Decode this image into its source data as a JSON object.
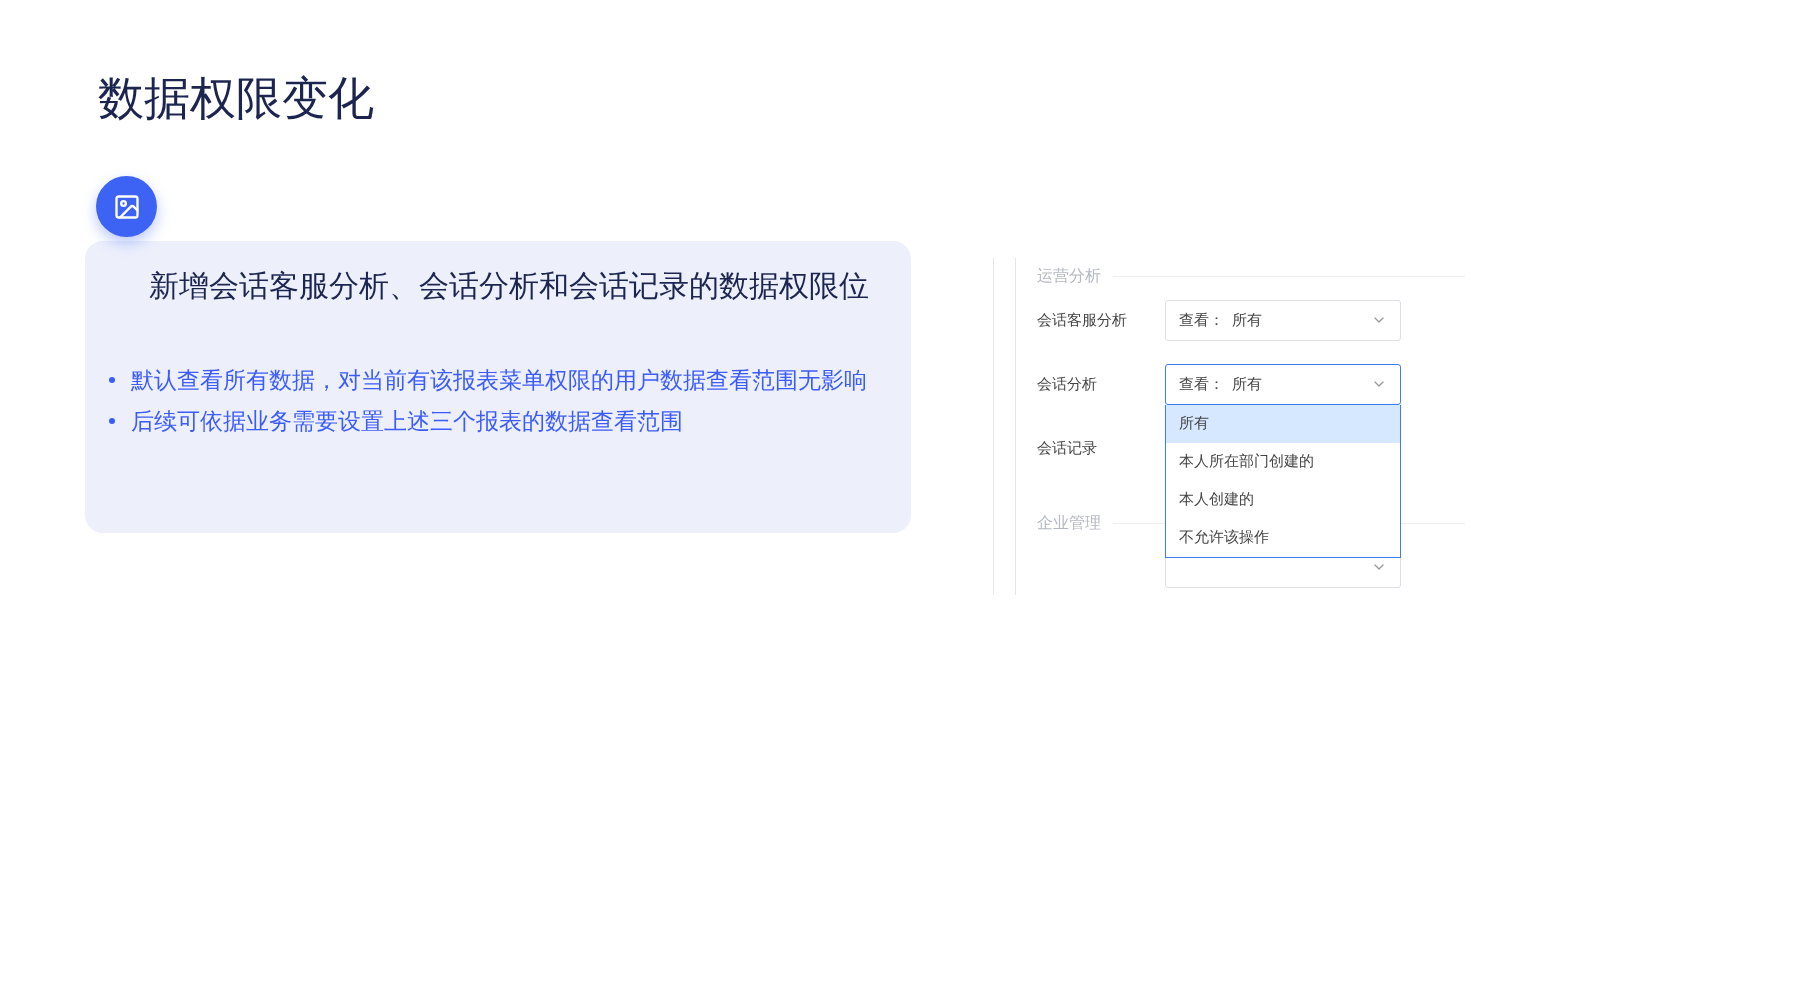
{
  "title": "数据权限变化",
  "card": {
    "heading": "新增会话客服分析、会话分析和会话记录的数据权限位",
    "bullets": [
      "默认查看所有数据，对当前有该报表菜单权限的用户数据查看范围无影响",
      "后续可依据业务需要设置上述三个报表的数据查看范围"
    ]
  },
  "settings": {
    "sections": [
      {
        "title": "运营分析",
        "rows": [
          {
            "label": "会话客服分析",
            "select": {
              "prefix": "查看：",
              "value": "所有",
              "expanded": false
            }
          },
          {
            "label": "会话分析",
            "select": {
              "prefix": "查看：",
              "value": "所有",
              "expanded": true,
              "options": [
                {
                  "label": "所有",
                  "selected": true
                },
                {
                  "label": "本人所在部门创建的",
                  "selected": false
                },
                {
                  "label": "本人创建的",
                  "selected": false
                },
                {
                  "label": "不允许该操作",
                  "selected": false
                }
              ]
            }
          },
          {
            "label": "会话记录"
          }
        ]
      },
      {
        "title": "企业管理",
        "rows": [
          {
            "select": {
              "expanded": false
            }
          }
        ]
      }
    ]
  }
}
